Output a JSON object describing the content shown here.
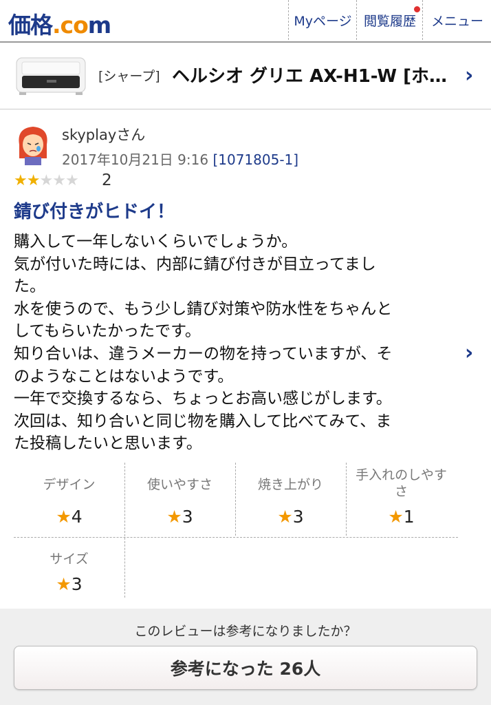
{
  "header": {
    "logo": {
      "part1": "価",
      "part2": "格",
      "part3": ".co",
      "part4": "m"
    },
    "nav": [
      "Myページ",
      "閲覧履歴",
      "メニュー"
    ]
  },
  "product": {
    "maker": "[シャープ]",
    "name": "ヘルシオ グリエ AX-H1-W [ホ…"
  },
  "review": {
    "user": "skyplayさん",
    "date": "2017年10月21日 9:16",
    "review_id": "[1071805-1]",
    "rating_stars": 2,
    "rating_text": "2",
    "title": "錆び付きがヒドイ！",
    "body": [
      "購入して一年しないくらいでしょうか。",
      "気が付いた時には、内部に錆び付きが目立ってまし",
      "た。",
      "水を使うので、もう少し錆び対策や防水性をちゃんと",
      "してもらいたかったです。",
      "知り合いは、違うメーカーの物を持っていますが、そ",
      "のようなことはないようです。",
      "一年で交換するなら、ちょっとお高い感じがします。",
      "次回は、知り合いと同じ物を購入して比べてみて、ま",
      "た投稿したいと思います。"
    ]
  },
  "ratings": [
    {
      "label": "デザイン",
      "value": "4"
    },
    {
      "label": "使いやすさ",
      "value": "3"
    },
    {
      "label": "焼き上がり",
      "value": "3"
    },
    {
      "label": "手入れのしやすさ",
      "value": "1"
    },
    {
      "label": "サイズ",
      "value": "3"
    }
  ],
  "footer": {
    "question": "このレビューは参考になりましたか？",
    "button": "参考になった 26人"
  },
  "colors": {
    "brand_blue": "#1d3a8a",
    "brand_orange": "#ef8a00",
    "star": "#f39800",
    "badge_dot": "#e03030"
  }
}
